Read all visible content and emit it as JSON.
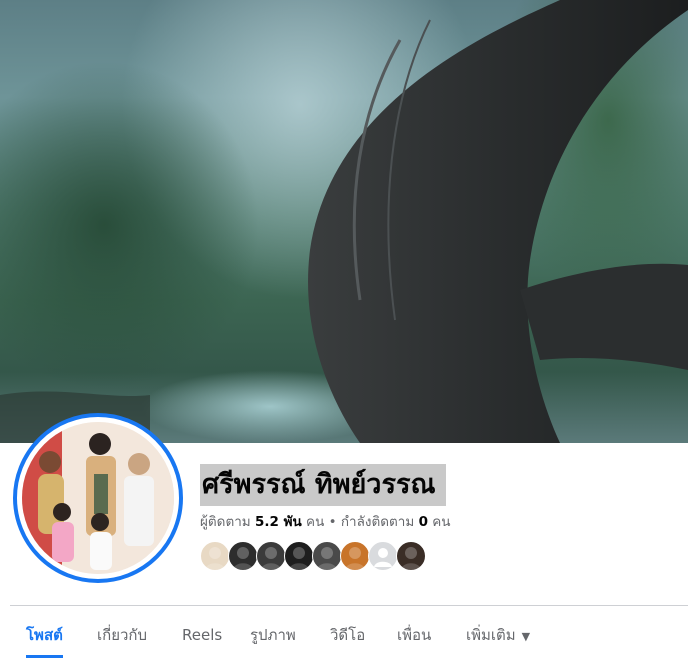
{
  "profile": {
    "name": "ศรีพรรณ์ ทิพย์วรรณ",
    "followers_label": "ผู้ติดตาม",
    "followers_count": "5.2 พัน",
    "followers_unit": "คน",
    "separator": "•",
    "following_label": "กำลังติดตาม",
    "following_count": "0",
    "following_unit": "คน"
  },
  "follower_avatars": [
    {
      "color": "#e8d9c4",
      "icon": "avatar"
    },
    {
      "color": "#2d2d2d",
      "icon": "avatar"
    },
    {
      "color": "#3b3b3b",
      "icon": "avatar"
    },
    {
      "color": "#1e1e1e",
      "icon": "avatar"
    },
    {
      "color": "#4a4a4a",
      "icon": "avatar"
    },
    {
      "color": "#c8742a",
      "icon": "avatar"
    },
    {
      "color": "#d9dbde",
      "icon": "default-avatar"
    },
    {
      "color": "#3a2d26",
      "icon": "avatar"
    }
  ],
  "tabs": [
    {
      "label": "โพสต์",
      "active": true
    },
    {
      "label": "เกี่ยวกับ",
      "active": false
    },
    {
      "label": "Reels",
      "active": false
    },
    {
      "label": "รูปภาพ",
      "active": false
    },
    {
      "label": "วิดีโอ",
      "active": false
    },
    {
      "label": "เพื่อน",
      "active": false
    },
    {
      "label": "เพิ่มเติม",
      "active": false,
      "icon": "caret-down-icon"
    }
  ],
  "colors": {
    "accent": "#1877f2",
    "text": "#050505",
    "muted": "#65676b"
  }
}
